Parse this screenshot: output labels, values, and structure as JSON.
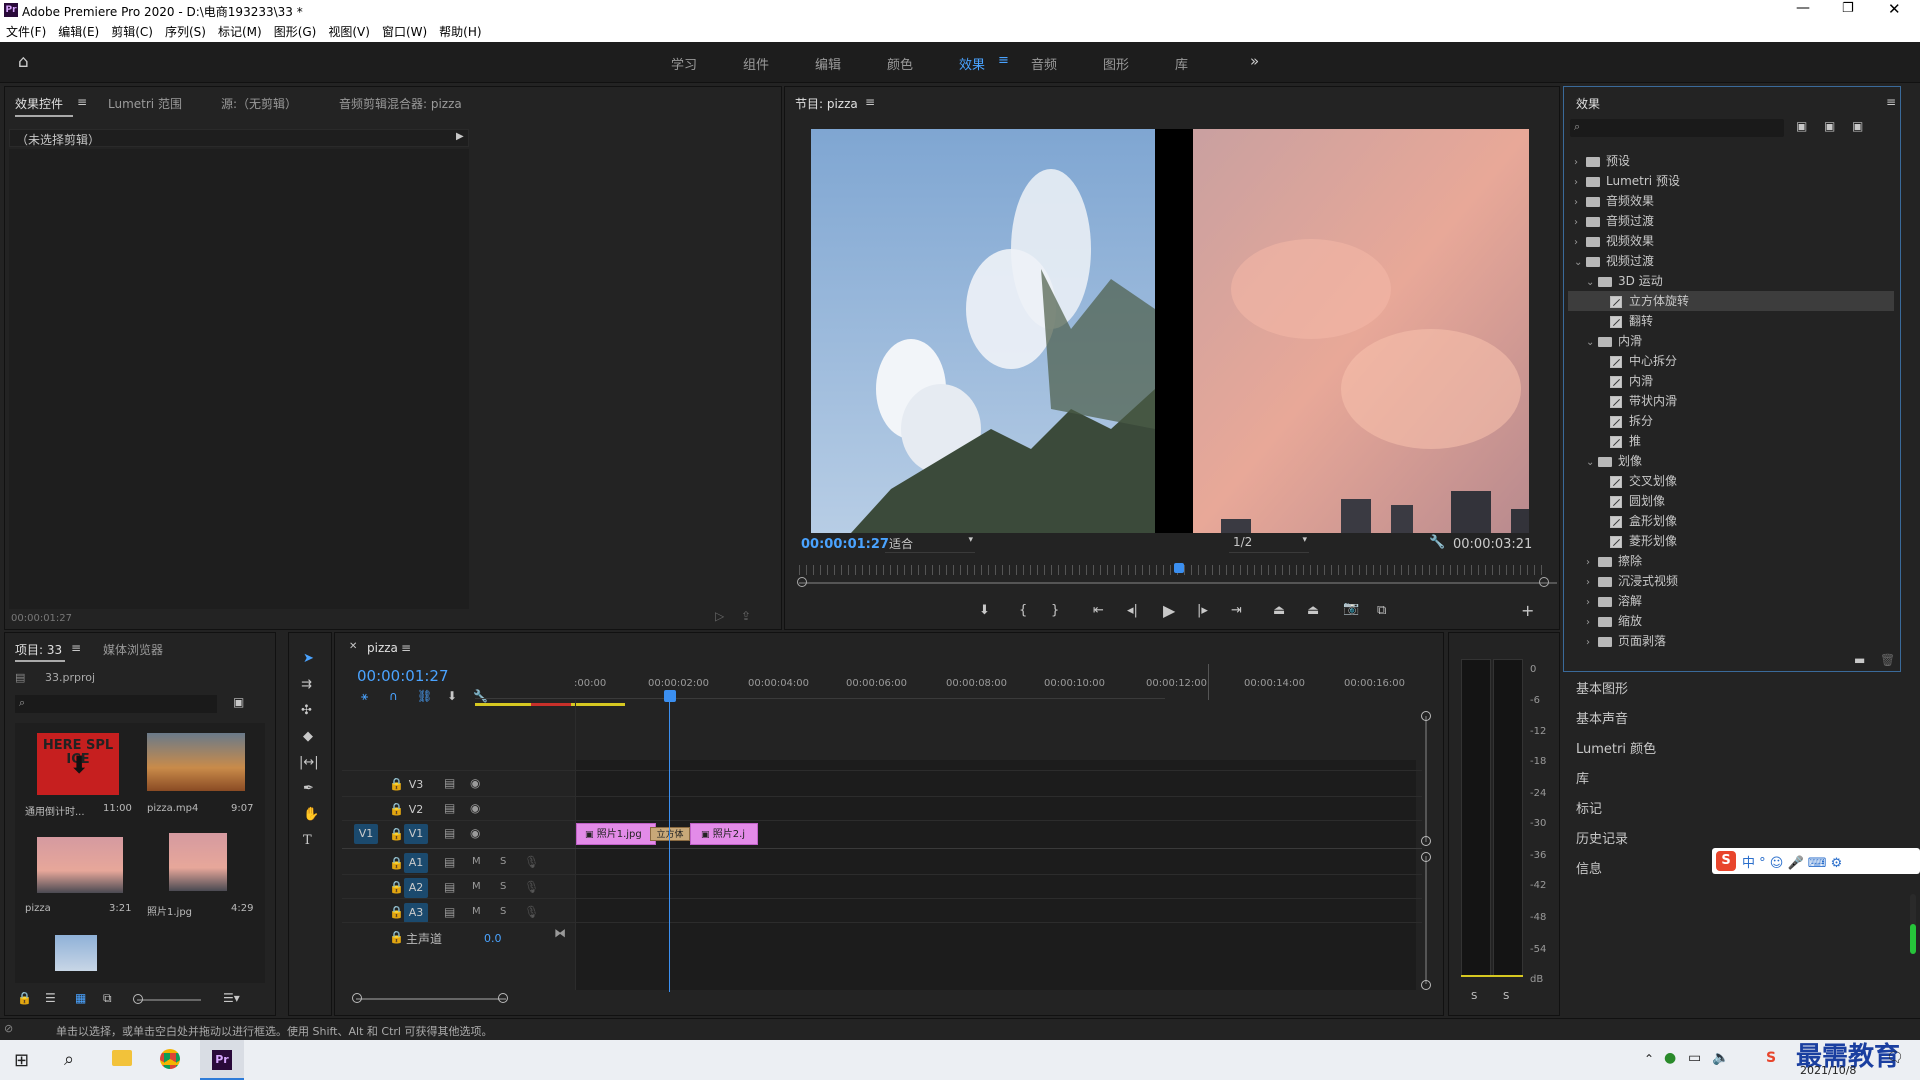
{
  "window": {
    "title": "Adobe Premiere Pro 2020 - D:\\电商193233\\33 *",
    "app_badge": "Pr"
  },
  "menu": [
    "文件(F)",
    "编辑(E)",
    "剪辑(C)",
    "序列(S)",
    "标记(M)",
    "图形(G)",
    "视图(V)",
    "窗口(W)",
    "帮助(H)"
  ],
  "workspaces": [
    "学习",
    "组件",
    "编辑",
    "颜色",
    "效果",
    "音频",
    "图形",
    "库"
  ],
  "active_workspace": "效果",
  "source_panel": {
    "tabs": [
      "效果控件",
      "Lumetri 范围",
      "源:（无剪辑）",
      "音频剪辑混合器: pizza"
    ],
    "no_clip": "（未选择剪辑）",
    "timecode": "00:00:01:27"
  },
  "program": {
    "title": "节目: pizza",
    "timecode": "00:00:01:27",
    "fit": "适合",
    "resolution": "1/2",
    "duration": "00:00:03:21"
  },
  "effects": {
    "title": "效果",
    "tree": [
      {
        "label": "预设",
        "type": "folder",
        "level": 0,
        "open": false
      },
      {
        "label": "Lumetri 预设",
        "type": "folder",
        "level": 0,
        "open": false
      },
      {
        "label": "音频效果",
        "type": "folder",
        "level": 0,
        "open": false
      },
      {
        "label": "音频过渡",
        "type": "folder",
        "level": 0,
        "open": false
      },
      {
        "label": "视频效果",
        "type": "folder",
        "level": 0,
        "open": false
      },
      {
        "label": "视频过渡",
        "type": "folder",
        "level": 0,
        "open": true
      },
      {
        "label": "3D 运动",
        "type": "folder",
        "level": 1,
        "open": true
      },
      {
        "label": "立方体旋转",
        "type": "fx",
        "level": 2,
        "selected": true
      },
      {
        "label": "翻转",
        "type": "fx",
        "level": 2
      },
      {
        "label": "内滑",
        "type": "folder",
        "level": 1,
        "open": true
      },
      {
        "label": "中心拆分",
        "type": "fx",
        "level": 2
      },
      {
        "label": "内滑",
        "type": "fx",
        "level": 2
      },
      {
        "label": "带状内滑",
        "type": "fx",
        "level": 2
      },
      {
        "label": "拆分",
        "type": "fx",
        "level": 2
      },
      {
        "label": "推",
        "type": "fx",
        "level": 2
      },
      {
        "label": "划像",
        "type": "folder",
        "level": 1,
        "open": true
      },
      {
        "label": "交叉划像",
        "type": "fx",
        "level": 2
      },
      {
        "label": "圆划像",
        "type": "fx",
        "level": 2
      },
      {
        "label": "盒形划像",
        "type": "fx",
        "level": 2
      },
      {
        "label": "菱形划像",
        "type": "fx",
        "level": 2
      },
      {
        "label": "擦除",
        "type": "folder",
        "level": 1,
        "open": false
      },
      {
        "label": "沉浸式视频",
        "type": "folder",
        "level": 1,
        "open": false
      },
      {
        "label": "溶解",
        "type": "folder",
        "level": 1,
        "open": false
      },
      {
        "label": "缩放",
        "type": "folder",
        "level": 1,
        "open": false
      },
      {
        "label": "页面剥落",
        "type": "folder",
        "level": 1,
        "open": false
      }
    ]
  },
  "side_panels": [
    "基本图形",
    "基本声音",
    "Lumetri 颜色",
    "库",
    "标记",
    "历史记录",
    "信息"
  ],
  "project": {
    "tabs": [
      "项目: 33",
      "媒体浏览器"
    ],
    "file": "33.prproj",
    "items": [
      {
        "name": "通用倒计时...",
        "dur": "11:00"
      },
      {
        "name": "pizza.mp4",
        "dur": "9:07"
      },
      {
        "name": "pizza",
        "dur": "3:21"
      },
      {
        "name": "照片1.jpg",
        "dur": "4:29"
      }
    ],
    "countdown_text": "HERE SPLICE"
  },
  "timeline": {
    "seq": "pizza",
    "timecode": "00:00:01:27",
    "ruler": [
      ":00:00",
      "00:00:02:00",
      "00:00:04:00",
      "00:00:06:00",
      "00:00:08:00",
      "00:00:10:00",
      "00:00:12:00",
      "00:00:14:00",
      "00:00:16:00"
    ],
    "video_tracks": [
      "V3",
      "V2",
      "V1"
    ],
    "audio_tracks": [
      "A1",
      "A2",
      "A3"
    ],
    "src_patch": "V1",
    "master": "主声道",
    "master_val": "0.0",
    "clips": {
      "a": "照片1.jpg",
      "t": "立方体",
      "b": "照片2.j"
    },
    "track_m": "M",
    "track_s": "S"
  },
  "meter": {
    "labels": [
      "0",
      "-6",
      "-12",
      "-18",
      "-24",
      "-30",
      "-36",
      "-42",
      "-48",
      "-54",
      "dB"
    ],
    "solo": "S"
  },
  "status": "单击以选择，或单击空白处并拖动以进行框选。使用 Shift、Alt 和 Ctrl 可获得其他选项。",
  "tray": {
    "date": "2021/10/8",
    "brand": "最需教育"
  },
  "colors": {
    "accent": "#2d8ceb",
    "clip": "#e38be8",
    "transition": "#c8a878"
  }
}
